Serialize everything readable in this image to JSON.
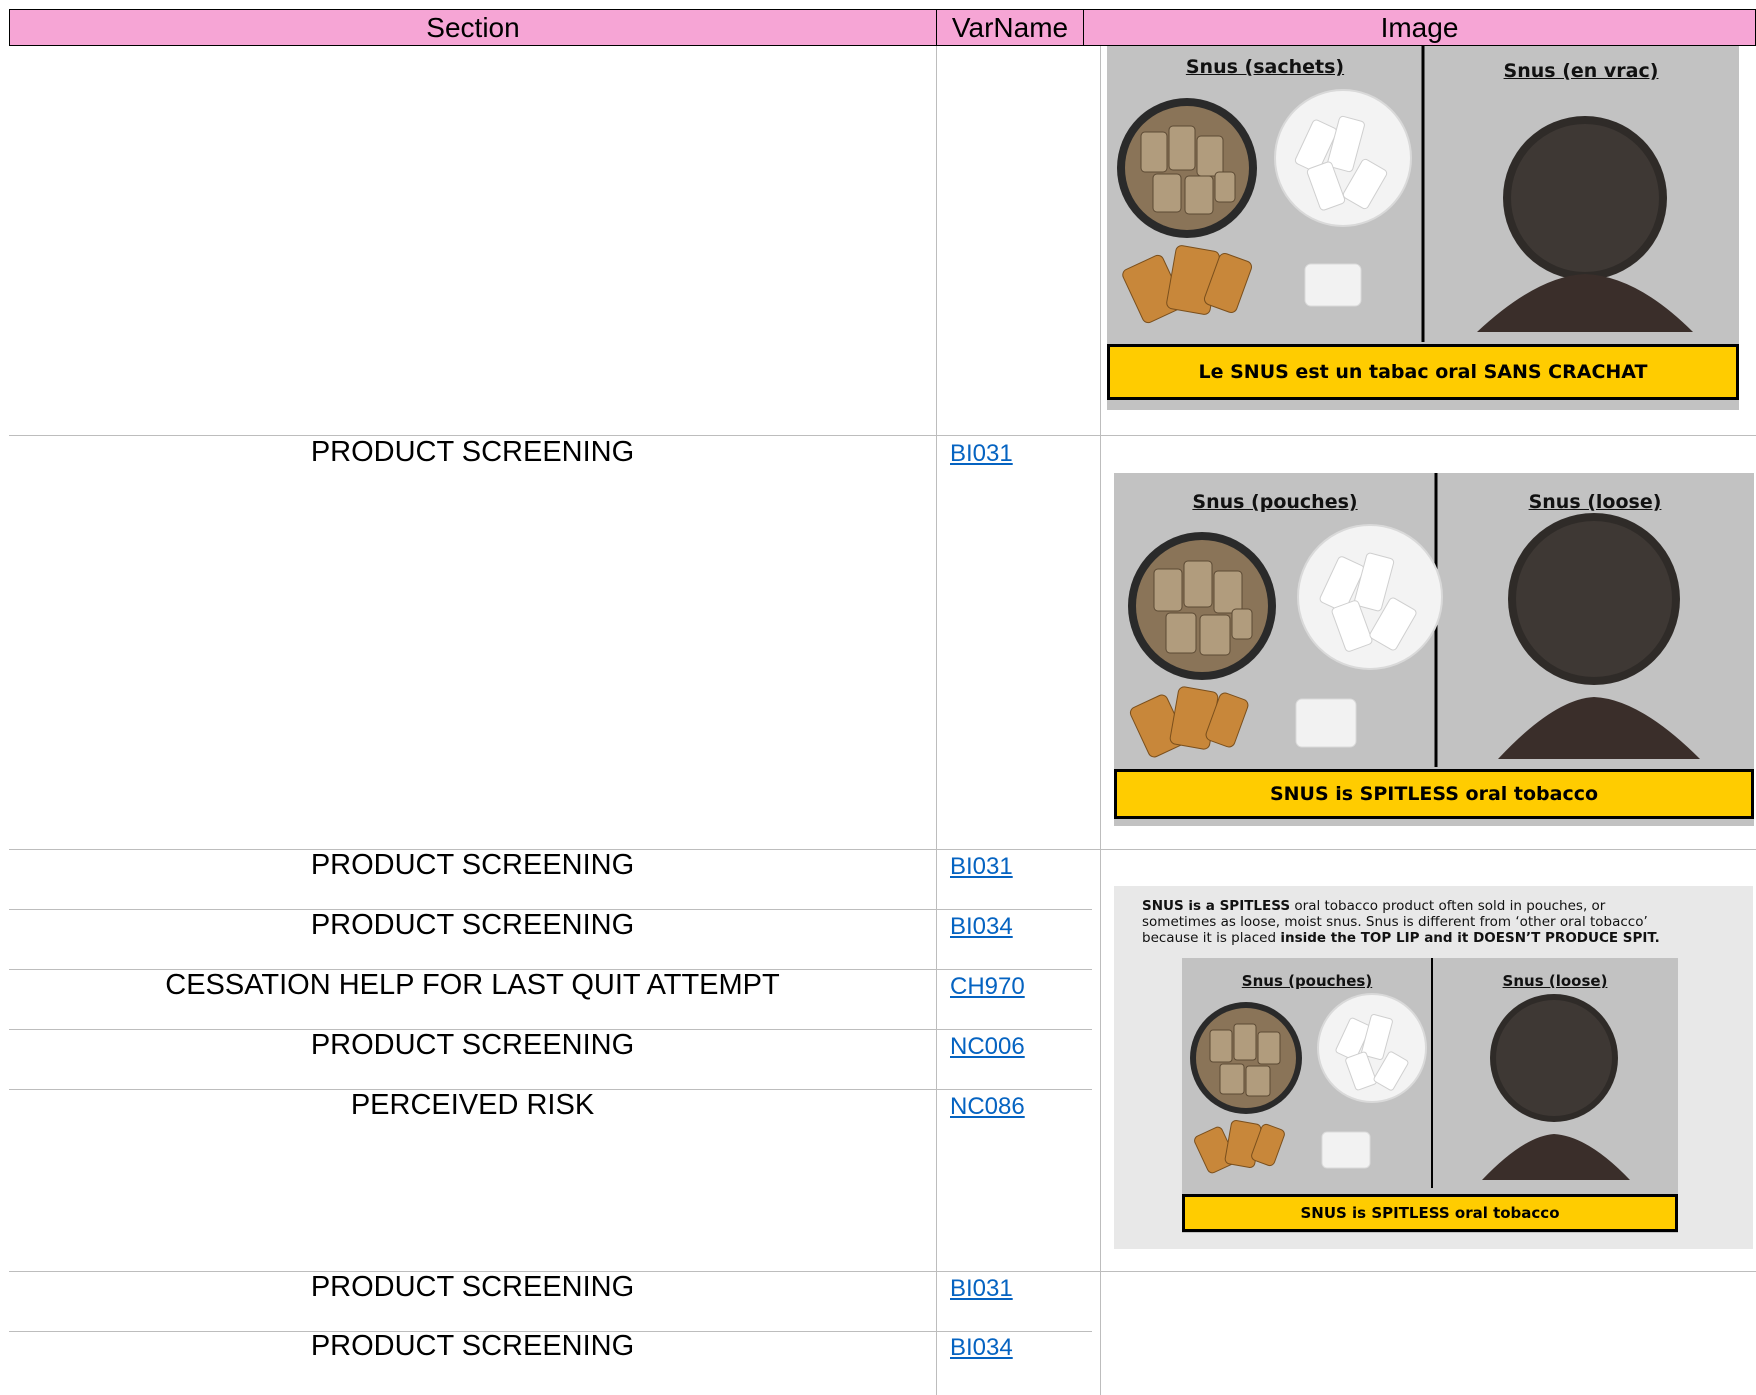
{
  "header": {
    "section": "Section",
    "varname": "VarName",
    "image": "Image"
  },
  "rows": [
    {
      "section": "",
      "var": ""
    },
    {
      "section": "PRODUCT SCREENING",
      "var": "BI031"
    },
    {
      "section": "PRODUCT SCREENING",
      "var": "BI031"
    },
    {
      "section": "PRODUCT SCREENING",
      "var": "BI034"
    },
    {
      "section": "CESSATION HELP FOR LAST QUIT ATTEMPT",
      "var": "CH970"
    },
    {
      "section": "PRODUCT SCREENING",
      "var": "NC006"
    },
    {
      "section": "PERCEIVED RISK",
      "var": "NC086"
    },
    {
      "section": "PRODUCT SCREENING",
      "var": "BI031"
    },
    {
      "section": "PRODUCT SCREENING",
      "var": "BI034"
    }
  ],
  "images": {
    "fr": {
      "left_title": "Snus (sachets)",
      "right_title": "Snus (en vrac)",
      "banner": "Le SNUS est un tabac oral SANS CRACHAT"
    },
    "en": {
      "left_title": "Snus (pouches)",
      "right_title": "Snus (loose)",
      "banner": "SNUS is SPITLESS oral tobacco"
    },
    "en_small": {
      "note_line1_bold": "SNUS is a SPITLESS",
      "note_line1_rest": " oral tobacco product often sold in pouches, or",
      "note_line2": "sometimes as loose, moist snus. Snus is different from ‘other oral tobacco’",
      "note_line3_start": "because it is placed ",
      "note_line3_bold": "inside the TOP LIP and it DOESN’T PRODUCE SPIT.",
      "left_title": "Snus (pouches)",
      "right_title": "Snus (loose)",
      "banner": "SNUS is SPITLESS oral tobacco"
    }
  },
  "colors": {
    "header_bg": "#f6a5d5",
    "link": "#0563c1",
    "banner": "#ffcc00",
    "panel_bg": "#c2c2c2"
  }
}
